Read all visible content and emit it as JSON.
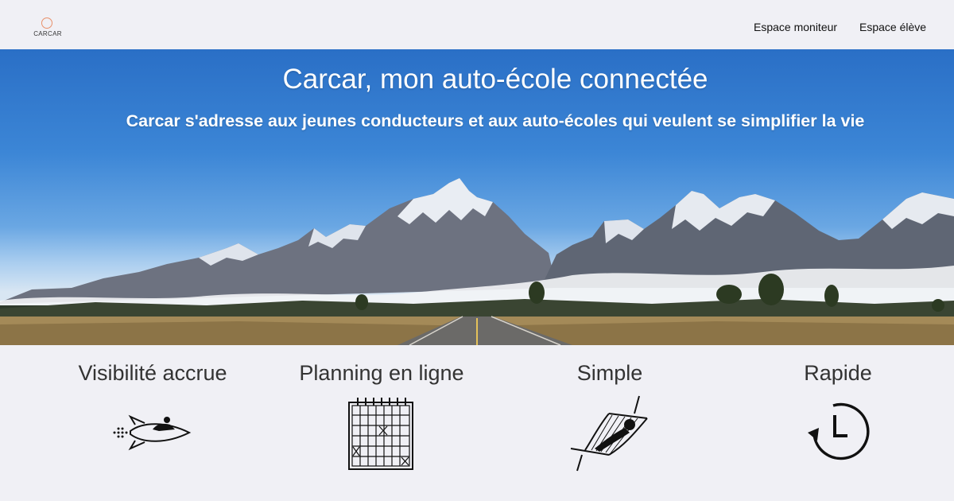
{
  "header": {
    "logo_text": "CARCAR",
    "nav": {
      "moniteur": "Espace moniteur",
      "eleve": "Espace élève"
    }
  },
  "hero": {
    "title": "Carcar, mon auto-école connectée",
    "subtitle": "Carcar s'adresse aux jeunes conducteurs et aux auto-écoles qui veulent se simplifier la vie",
    "background": "mountain-road-photo"
  },
  "features": [
    {
      "title": "Visibilité accrue",
      "icon": "rocket-icon"
    },
    {
      "title": "Planning en ligne",
      "icon": "calendar-icon"
    },
    {
      "title": "Simple",
      "icon": "hammock-icon"
    },
    {
      "title": "Rapide",
      "icon": "clock-icon"
    }
  ],
  "colors": {
    "page_bg": "#f0f0f5",
    "sky": "#3c86d6",
    "logo_accent": "#e8906a",
    "text": "#333333"
  }
}
